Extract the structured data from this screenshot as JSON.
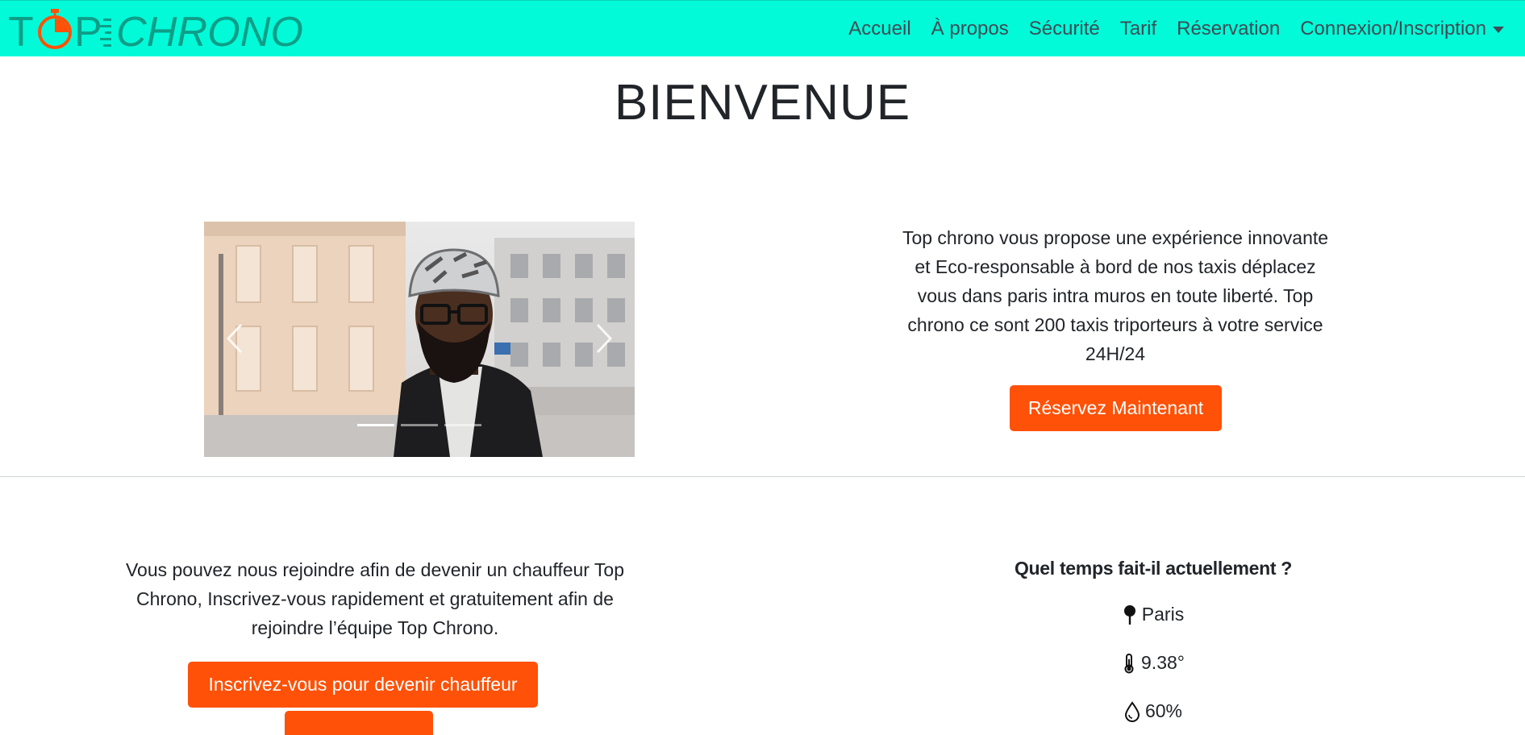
{
  "brand": {
    "logo_text": "TOP CHRONO",
    "color_primary": "#02fad8",
    "color_accent": "#ff5107",
    "logo_color": "#0e9e87",
    "logo_clock_color": "#ff5107"
  },
  "nav": {
    "items": [
      {
        "label": "Accueil"
      },
      {
        "label": "À propos"
      },
      {
        "label": "Sécurité"
      },
      {
        "label": "Tarif"
      },
      {
        "label": "Réservation"
      },
      {
        "label": "Connexion/Inscription",
        "dropdown": true
      }
    ]
  },
  "hero": {
    "title": "BIENVENUE"
  },
  "carousel": {
    "slides": 3,
    "active_index": 0,
    "prev_icon": "chevron-left-icon",
    "next_icon": "chevron-right-icon"
  },
  "intro": {
    "text": "Top chrono vous propose une expérience innovante et Eco-responsable à bord de nos taxis déplacez vous dans paris intra muros en toute liberté. Top chrono ce sont 200 taxis triporteurs à votre service 24H/24",
    "button_label": "Réservez Maintenant"
  },
  "join": {
    "text": "Vous pouvez nous rejoindre afin de devenir un chauffeur Top Chrono, Inscrivez-vous rapidement et gratuitement afin de rejoindre l’équipe Top Chrono.",
    "button_label": "Inscrivez-vous pour devenir chauffeur"
  },
  "weather": {
    "title": "Quel temps fait-il actuellement ?",
    "city": "Paris",
    "temperature": "9.38°",
    "humidity": "60%",
    "icons": [
      "map-pin-icon",
      "thermometer-icon",
      "droplet-icon"
    ]
  }
}
